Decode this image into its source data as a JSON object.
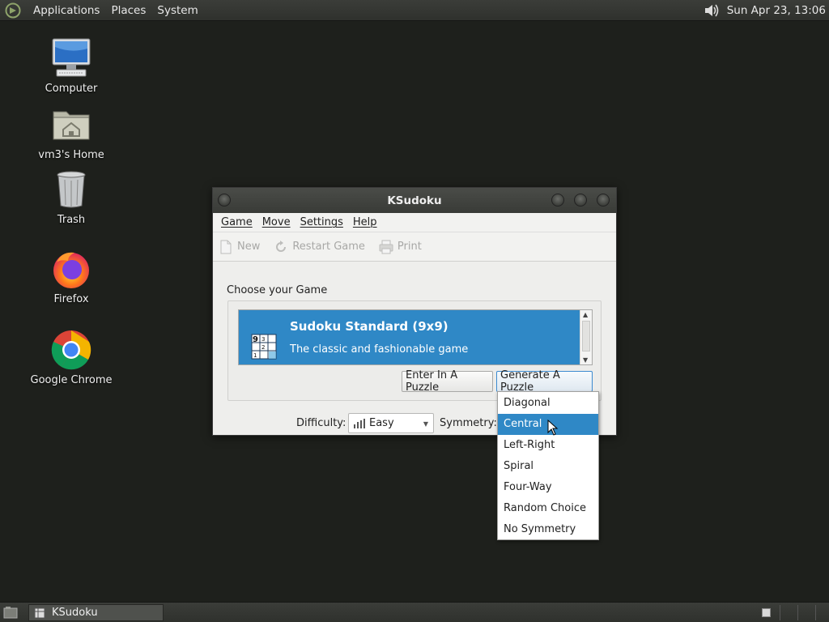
{
  "top_panel": {
    "menus": [
      "Applications",
      "Places",
      "System"
    ],
    "clock": "Sun Apr 23, 13:06"
  },
  "desktop": {
    "icons": [
      {
        "label": "Computer",
        "icon": "computer-icon"
      },
      {
        "label": "vm3's Home",
        "icon": "home-folder-icon"
      },
      {
        "label": "Trash",
        "icon": "trash-icon"
      },
      {
        "label": "Firefox",
        "icon": "firefox-icon"
      },
      {
        "label": "Google Chrome",
        "icon": "chrome-icon"
      }
    ]
  },
  "window": {
    "title": "KSudoku",
    "menu": [
      "Game",
      "Move",
      "Settings",
      "Help"
    ],
    "toolbar": {
      "new": "New",
      "restart": "Restart Game",
      "print": "Print"
    },
    "choose_label": "Choose your Game",
    "games": [
      {
        "title": "Sudoku Standard (9x9)",
        "description": "The classic and fashionable game",
        "selected": true
      }
    ],
    "buttons": {
      "enter_puzzle": "Enter In A Puzzle",
      "generate_puzzle": "Generate A Puzzle"
    },
    "difficulty_label": "Difficulty:",
    "difficulty_value": "Easy",
    "symmetry_label": "Symmetry:"
  },
  "symmetry_dropdown": {
    "options": [
      "Diagonal",
      "Central",
      "Left-Right",
      "Spiral",
      "Four-Way",
      "Random Choice",
      "No Symmetry"
    ],
    "highlighted": "Central"
  },
  "taskbar": {
    "tasks": [
      {
        "label": "KSudoku",
        "active": true
      }
    ]
  },
  "colors": {
    "selection": "#2f88c6",
    "panel": "#333531",
    "desktop": "#1e201c"
  }
}
